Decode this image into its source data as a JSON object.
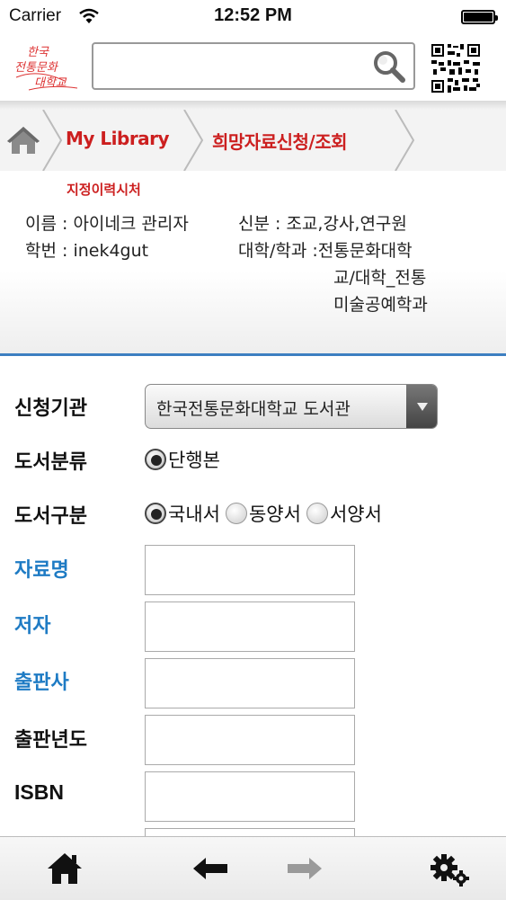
{
  "status_bar": {
    "carrier": "Carrier",
    "time": "12:52 PM"
  },
  "header": {
    "logo_text": "한국전통문화대학교",
    "search": {
      "value": "",
      "placeholder": ""
    }
  },
  "breadcrumb": {
    "items": [
      {
        "label": "My Library"
      },
      {
        "label": "희망자료신청/조회"
      }
    ]
  },
  "info": {
    "title": "지정이력시처",
    "name": "이름 : 아이네크 관리자",
    "id": "학번 : inek4gut",
    "status": "신분 : 조교,강사,연구원",
    "dept_line1": "대학/학과 :전통문화대학",
    "dept_line2": "교/대학_전통",
    "dept_line3": "미술공예학과"
  },
  "form": {
    "institution": {
      "label": "신청기관",
      "value": "한국전통문화대학교 도서관"
    },
    "book_class": {
      "label": "도서분류",
      "options": [
        "단행본"
      ],
      "selected": 0
    },
    "book_type": {
      "label": "도서구분",
      "options": [
        "국내서",
        "동양서",
        "서양서"
      ],
      "selected": 0
    },
    "title_field": {
      "label": "자료명",
      "value": ""
    },
    "author_field": {
      "label": "저자",
      "value": ""
    },
    "publisher_field": {
      "label": "출판사",
      "value": ""
    },
    "year_field": {
      "label": "출판년도",
      "value": ""
    },
    "isbn_field": {
      "label": "ISBN",
      "value": ""
    }
  },
  "tabbar": {
    "items": [
      {
        "icon": "home-icon"
      },
      {
        "icon": "back-arrow-icon"
      },
      {
        "icon": "forward-arrow-icon"
      },
      {
        "icon": "gear-icon"
      }
    ]
  },
  "colors": {
    "accent_red": "#cc1f1f",
    "link_blue": "#1e7bc4",
    "divider_blue": "#3d7fc1"
  }
}
